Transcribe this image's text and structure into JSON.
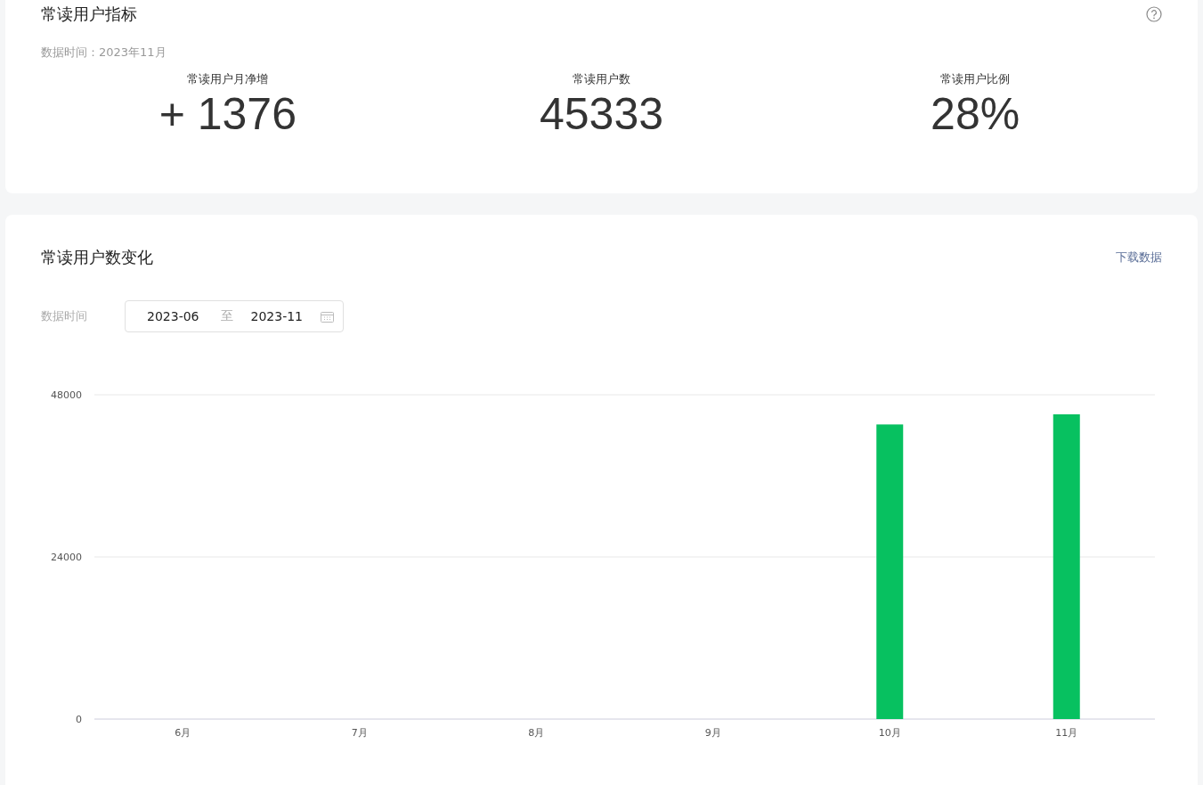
{
  "metrics_card": {
    "title": "常读用户指标",
    "data_time": "数据时间：2023年11月",
    "metrics": [
      {
        "label": "常读用户月净增",
        "value": "+ 1376"
      },
      {
        "label": "常读用户数",
        "value": "45333"
      },
      {
        "label": "常读用户比例",
        "value": "28%"
      }
    ]
  },
  "trend_card": {
    "title": "常读用户数变化",
    "download_link": "下载数据",
    "date_filter": {
      "label": "数据时间",
      "start": "2023-06",
      "separator": "至",
      "end": "2023-11"
    },
    "chart_data": {
      "type": "bar",
      "categories": [
        "6月",
        "7月",
        "8月",
        "9月",
        "10月",
        "11月"
      ],
      "series": [
        {
          "color": "#07c160",
          "values": [
            0,
            0,
            0,
            0,
            43600,
            45100
          ]
        }
      ],
      "ylim": [
        0,
        48000
      ],
      "yticks": [
        0,
        24000,
        48000
      ]
    }
  }
}
